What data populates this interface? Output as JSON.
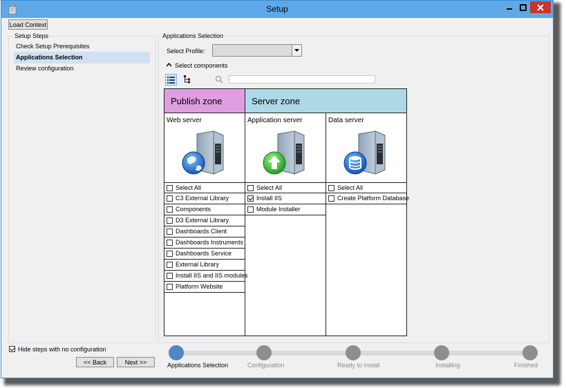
{
  "window": {
    "title": "Setup"
  },
  "toolbar": {
    "load_context": "Load Context"
  },
  "setup_steps": {
    "legend": "Setup Steps",
    "items": [
      {
        "label": "Check Setup Prerequisites",
        "selected": false
      },
      {
        "label": "Applications Selection",
        "selected": true
      },
      {
        "label": "Review configuration",
        "selected": false
      }
    ]
  },
  "apps": {
    "legend": "Applications Selection",
    "profile_label": "Select Profile:",
    "profile_value": "",
    "components_label": "Select components",
    "search_value": "",
    "zones": {
      "publish": "Publish zone",
      "server": "Server zone"
    },
    "columns": [
      {
        "title": "Web server",
        "icon": "web-server-globe-icon",
        "items": [
          {
            "label": "Select All",
            "checked": false
          },
          {
            "label": "C3 External Library",
            "checked": false
          },
          {
            "label": "Components",
            "checked": false
          },
          {
            "label": "D3 External Library",
            "checked": false
          },
          {
            "label": "Dashboards Client",
            "checked": false
          },
          {
            "label": "Dashboards Instruments",
            "checked": false
          },
          {
            "label": "Dashboards Service",
            "checked": false
          },
          {
            "label": "External Library",
            "checked": false
          },
          {
            "label": "Install IIS and IIS modules",
            "checked": false
          },
          {
            "label": "Platform Website",
            "checked": false
          }
        ]
      },
      {
        "title": "Application server",
        "icon": "application-server-upload-icon",
        "items": [
          {
            "label": "Select All",
            "checked": false
          },
          {
            "label": "Install IIS",
            "checked": true
          },
          {
            "label": "Module Installer",
            "checked": false
          }
        ]
      },
      {
        "title": "Data server",
        "icon": "data-server-database-icon",
        "items": [
          {
            "label": "Select All",
            "checked": false
          },
          {
            "label": "Create Platform Database",
            "checked": false
          }
        ]
      }
    ]
  },
  "footer": {
    "hide_steps_label": "Hide steps with no configuration",
    "hide_steps_checked": true,
    "back": "<< Back",
    "next": "Next >>"
  },
  "progress": {
    "current": 0,
    "steps": [
      "Applications Selection",
      "Configuration",
      "Ready to install",
      "Installing",
      "Finished"
    ]
  },
  "colors": {
    "titlebar": "#5fa8e8",
    "publish_zone": "#df9de2",
    "server_zone": "#add8e5",
    "active_step": "#4f86c6",
    "close_button": "#c7352c"
  }
}
